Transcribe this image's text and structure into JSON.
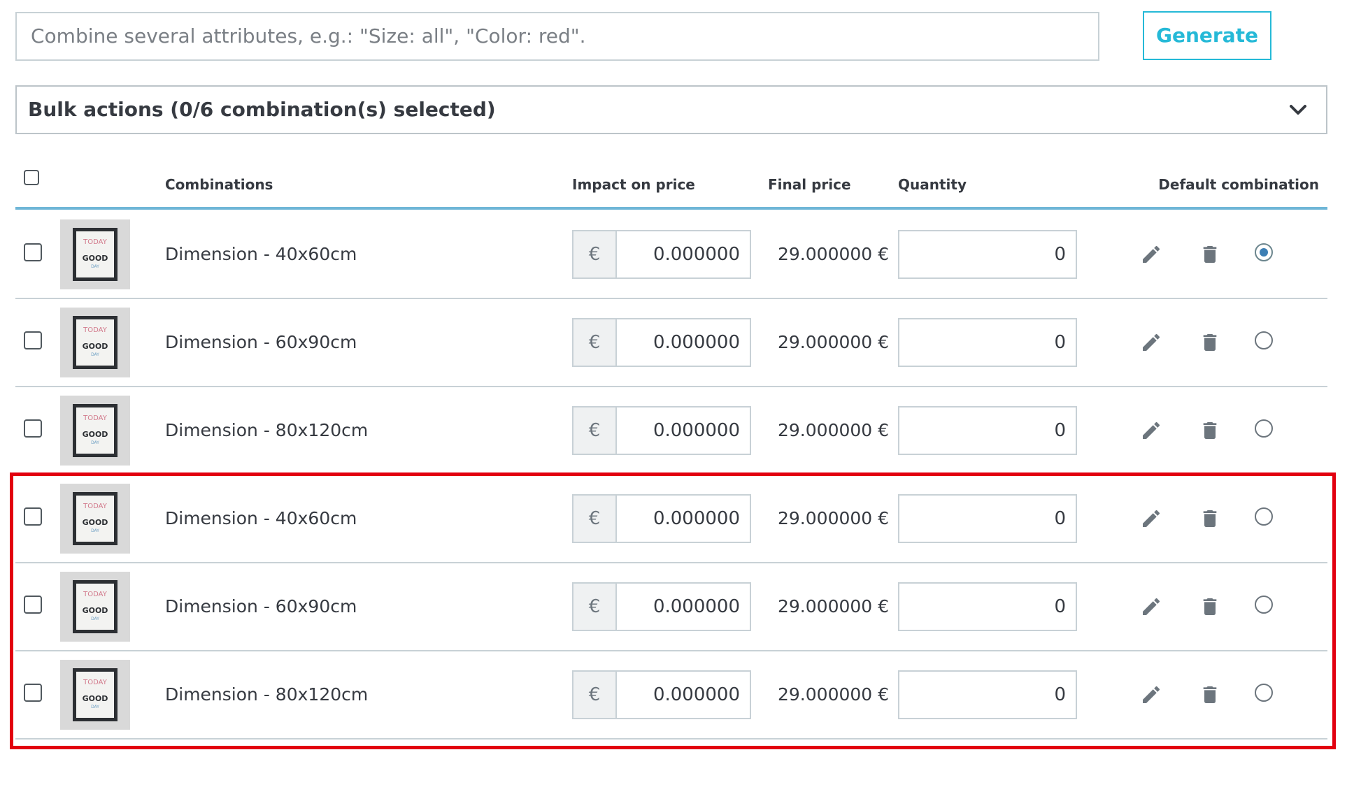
{
  "search": {
    "placeholder": "Combine several attributes, e.g.: \"Size: all\", \"Color: red\"."
  },
  "generate_label": "Generate",
  "bulk_actions_label": "Bulk actions (0/6 combination(s) selected)",
  "table": {
    "headers": {
      "combinations": "Combinations",
      "impact": "Impact on price",
      "final": "Final price",
      "quantity": "Quantity",
      "default": "Default combination"
    },
    "currency_symbol": "€",
    "rows": [
      {
        "name": "Dimension - 40x60cm",
        "impact": "0.000000",
        "final_price": "29.000000 €",
        "quantity": "0",
        "default": true
      },
      {
        "name": "Dimension - 60x90cm",
        "impact": "0.000000",
        "final_price": "29.000000 €",
        "quantity": "0",
        "default": false
      },
      {
        "name": "Dimension - 80x120cm",
        "impact": "0.000000",
        "final_price": "29.000000 €",
        "quantity": "0",
        "default": false
      },
      {
        "name": "Dimension - 40x60cm",
        "impact": "0.000000",
        "final_price": "29.000000 €",
        "quantity": "0",
        "default": false
      },
      {
        "name": "Dimension - 60x90cm",
        "impact": "0.000000",
        "final_price": "29.000000 €",
        "quantity": "0",
        "default": false
      },
      {
        "name": "Dimension - 80x120cm",
        "impact": "0.000000",
        "final_price": "29.000000 €",
        "quantity": "0",
        "default": false
      }
    ],
    "thumbnail_text": {
      "line1": "TODAY",
      "line2": "GOOD",
      "line3": "DAY"
    }
  },
  "colors": {
    "accent": "#25b9d7",
    "highlight": "#e2000f",
    "header_rule": "#6fb6d7"
  }
}
